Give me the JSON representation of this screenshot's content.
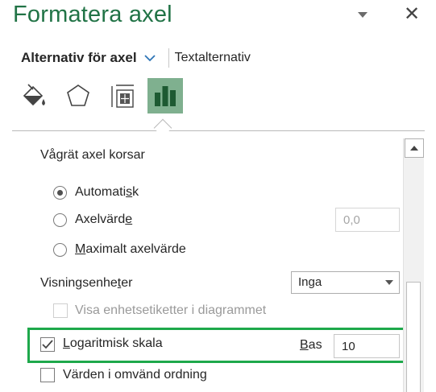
{
  "pane": {
    "title": "Formatera axel"
  },
  "tabs": {
    "axis_options": "Alternativ för axel",
    "text_options": "Textalternativ"
  },
  "icons": [
    "fill-line-icon",
    "effects-icon",
    "size-properties-icon",
    "axis-options-icon"
  ],
  "horizontal_axis": {
    "heading": "Vågrät axel korsar",
    "automatic": {
      "pre": "Automati",
      "key": "s",
      "post": "k",
      "selected": true
    },
    "axis_value": {
      "pre": "Axelvärd",
      "key": "e",
      "post": "",
      "value": "0,0",
      "selected": false
    },
    "max_axis_value": {
      "pre": "",
      "key": "M",
      "post": "aximalt axelvärde",
      "selected": false
    }
  },
  "display_units": {
    "label_pre": "Visningsenhe",
    "label_key": "t",
    "label_post": "er",
    "selected": "Inga",
    "show_label": {
      "text": "Visa enhetsetiketter i diagrammet",
      "checked": false,
      "enabled": false
    }
  },
  "log_scale": {
    "label_pre": "",
    "label_key": "L",
    "label_post": "ogaritmisk skala",
    "checked": true,
    "base_label_pre": "",
    "base_label_key": "B",
    "base_label_post": "as",
    "base_value": "10"
  },
  "reverse_order": {
    "text": "Värden i omvänd ordning",
    "checked": false
  },
  "colors": {
    "title": "#217346",
    "selected_icon_bg": "#7fb08f",
    "highlight": "#1ea84b"
  }
}
